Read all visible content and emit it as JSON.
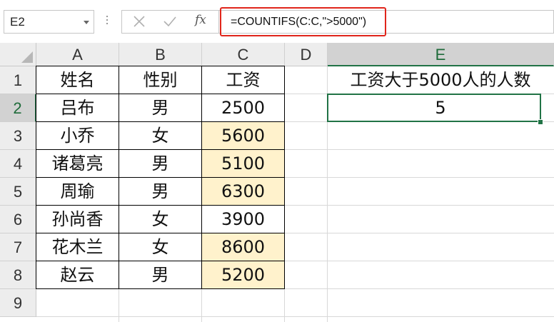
{
  "name_box": {
    "value": "E2"
  },
  "formula_bar": {
    "cancel_icon": "close-icon",
    "enter_icon": "check-icon",
    "fx_label": "fx",
    "formula": "=COUNTIFS(C:C,\">5000\")",
    "highlight_color": "#e0251b"
  },
  "columns": [
    "A",
    "B",
    "C",
    "D",
    "E"
  ],
  "rows": [
    "1",
    "2",
    "3",
    "4",
    "5",
    "6",
    "7",
    "8",
    "9"
  ],
  "table": {
    "headers": [
      "姓名",
      "性别",
      "工资"
    ],
    "records": [
      [
        "吕布",
        "男",
        "2500"
      ],
      [
        "小乔",
        "女",
        "5600"
      ],
      [
        "诸葛亮",
        "男",
        "5100"
      ],
      [
        "周瑜",
        "男",
        "6300"
      ],
      [
        "孙尚香",
        "女",
        "3900"
      ],
      [
        "花木兰",
        "女",
        "8600"
      ],
      [
        "赵云",
        "男",
        "5200"
      ]
    ],
    "highlight_color": "#fff2cc"
  },
  "result": {
    "label": "工资大于5000人的人数",
    "value": "5"
  },
  "selected_cell": "E2",
  "accent_color": "#217346"
}
